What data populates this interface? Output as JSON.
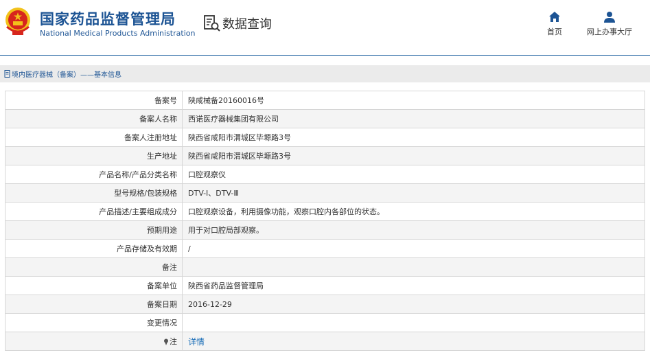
{
  "header": {
    "org_name_cn": "国家药品监督管理局",
    "org_name_en": "National Medical Products Administration",
    "query_title": "数据查询"
  },
  "nav": {
    "home_label": "首页",
    "service_label": "网上办事大厅"
  },
  "breadcrumb": {
    "text": "境内医疗器械（备案）——基本信息"
  },
  "record": {
    "rows": [
      {
        "label": "备案号",
        "value": "陕咸械备20160016号"
      },
      {
        "label": "备案人名称",
        "value": "西诺医疗器械集团有限公司"
      },
      {
        "label": "备案人注册地址",
        "value": "陕西省咸阳市渭城区毕塬路3号"
      },
      {
        "label": "生产地址",
        "value": "陕西省咸阳市渭城区毕塬路3号"
      },
      {
        "label": "产品名称/产品分类名称",
        "value": "口腔观察仪"
      },
      {
        "label": "型号规格/包装规格",
        "value": "DTV-Ⅰ、DTV-Ⅲ"
      },
      {
        "label": "产品描述/主要组成成分",
        "value": "口腔观察设备，利用摄像功能，观察口腔内各部位的状态。"
      },
      {
        "label": "预期用途",
        "value": "用于对口腔局部观察。"
      },
      {
        "label": "产品存储及有效期",
        "value": "/"
      },
      {
        "label": "备注",
        "value": ""
      },
      {
        "label": "备案单位",
        "value": "陕西省药品监督管理局"
      },
      {
        "label": "备案日期",
        "value": "2016-12-29"
      },
      {
        "label": "变更情况",
        "value": ""
      }
    ],
    "note_label": "注",
    "note_link": "详情"
  },
  "colors": {
    "brand_blue": "#1d5494",
    "link_blue": "#1d6fb8",
    "emblem_red": "#d7261d",
    "emblem_gold": "#f2c21b"
  }
}
